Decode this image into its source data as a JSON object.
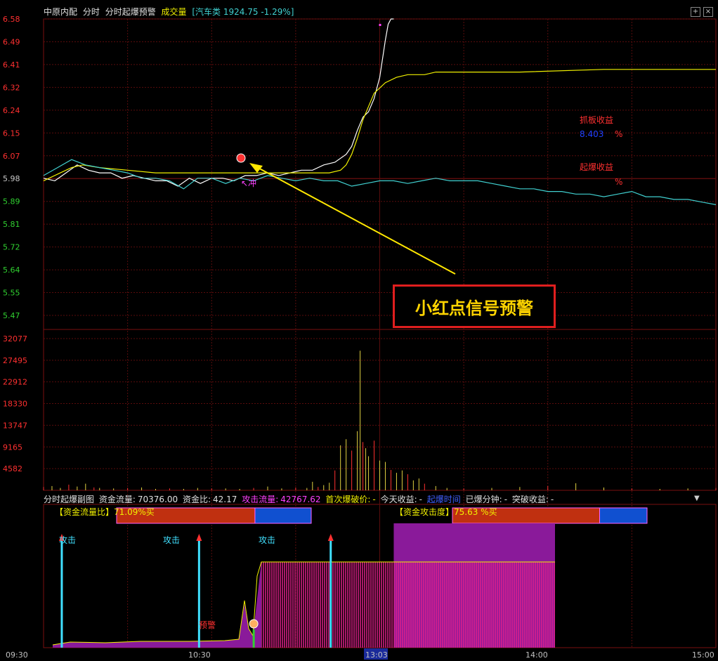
{
  "header": {
    "stock_name": "中原内配",
    "mode": "分时",
    "indicator": "分时起爆预警",
    "volume_label": "成交量",
    "sector": "[汽车类",
    "sector_value": "1924.75 -1.29%]"
  },
  "price_axis": {
    "ticks": [
      "6.58",
      "6.49",
      "6.41",
      "6.32",
      "6.24",
      "6.15",
      "6.07",
      "5.98",
      "5.89",
      "5.81",
      "5.72",
      "5.64",
      "5.55",
      "5.47"
    ],
    "colors": {
      "up": "#ff3030",
      "base": "#c8c8c8",
      "down": "#30d030"
    }
  },
  "volume_axis": {
    "ticks": [
      "32077",
      "27495",
      "22912",
      "18330",
      "13747",
      "9165",
      "4582"
    ]
  },
  "time_axis": {
    "labels": [
      "09:30",
      "10:30",
      "13:03",
      "14:00",
      "15:00"
    ]
  },
  "right_panel": {
    "grab_label": "抓板收益",
    "grab_value": "8.403",
    "grab_unit": "%",
    "burst_label": "起爆收益",
    "burst_unit": "%"
  },
  "signals": {
    "chong": "↖冲",
    "attack": "攻击",
    "warn": "预警"
  },
  "callout": {
    "text": "小红点信号预警"
  },
  "sub_panel": {
    "title": "分时起爆副图",
    "fund_flow_label": "资金流量:",
    "fund_flow_value": "70376.00",
    "fund_ratio_label": "资金比:",
    "fund_ratio_value": "42.17",
    "attack_flow_label": "攻击流量:",
    "attack_flow_value": "42767.62",
    "first_burst_label": "首次爆破价:",
    "first_burst_value": "-",
    "today_gain_label": "今天收益:",
    "today_gain_value": "-",
    "burst_time_label": "起爆时间",
    "burst_minutes_label": "已爆分钟:",
    "burst_minutes_value": "-",
    "breakout_gain_label": "突破收益:",
    "breakout_gain_value": "-",
    "flow_ratio_bar": "【资金流量比】71.09%买",
    "attack_degree_bar": "【资金攻击度】75.63 %买"
  },
  "chart_data": {
    "type": "line",
    "ylim": [
      5.43,
      6.6
    ],
    "base_price": 5.98,
    "time_range": [
      "09:30",
      "15:00"
    ],
    "series": [
      {
        "name": "价格",
        "color": "#ffffff",
        "minute_index": [
          0,
          4,
          8,
          12,
          16,
          20,
          24,
          28,
          32,
          36,
          40,
          44,
          48,
          52,
          56,
          60,
          64,
          68,
          72,
          76,
          80,
          84,
          88,
          92,
          96,
          100,
          104,
          108,
          110,
          112,
          114,
          116,
          118,
          120,
          121,
          122,
          123,
          124,
          125
        ],
        "values": [
          6.0,
          5.99,
          6.02,
          6.05,
          6.03,
          6.02,
          6.02,
          6.0,
          6.01,
          6.0,
          5.99,
          5.99,
          5.97,
          6.0,
          5.98,
          6.0,
          6.0,
          5.99,
          6.01,
          6.01,
          6.02,
          6.01,
          6.02,
          6.03,
          6.03,
          6.05,
          6.06,
          6.09,
          6.12,
          6.18,
          6.23,
          6.25,
          6.3,
          6.38,
          6.45,
          6.52,
          6.58,
          6.6,
          6.6
        ]
      },
      {
        "name": "均价",
        "color": "#f0f000",
        "minute_index": [
          0,
          6,
          10,
          14,
          20,
          30,
          40,
          60,
          80,
          96,
          102,
          106,
          108,
          110,
          112,
          114,
          116,
          118,
          122,
          126,
          130,
          136,
          140,
          150,
          170,
          200,
          230,
          240
        ],
        "values": [
          5.99,
          6.02,
          6.04,
          6.05,
          6.04,
          6.03,
          6.02,
          6.02,
          6.02,
          6.02,
          6.02,
          6.03,
          6.05,
          6.09,
          6.15,
          6.22,
          6.27,
          6.32,
          6.36,
          6.38,
          6.39,
          6.39,
          6.4,
          6.4,
          6.4,
          6.41,
          6.41,
          6.41
        ]
      },
      {
        "name": "汽车类",
        "color": "#40d0d0",
        "minute_index": [
          0,
          5,
          10,
          15,
          20,
          25,
          30,
          35,
          40,
          45,
          50,
          55,
          60,
          65,
          70,
          75,
          80,
          85,
          90,
          95,
          100,
          105,
          110,
          115,
          120,
          125,
          130,
          135,
          140,
          145,
          150,
          155,
          160,
          165,
          170,
          175,
          180,
          185,
          190,
          195,
          200,
          205,
          210,
          215,
          220,
          225,
          230,
          235,
          240
        ],
        "values": [
          6.01,
          6.04,
          6.07,
          6.05,
          6.04,
          6.03,
          6.02,
          6.0,
          6.0,
          5.99,
          5.96,
          6.0,
          6.0,
          5.98,
          6.0,
          5.99,
          6.01,
          6.0,
          5.99,
          6.0,
          5.99,
          5.99,
          5.97,
          5.98,
          5.99,
          5.99,
          5.98,
          5.99,
          6.0,
          5.99,
          5.99,
          5.99,
          5.98,
          5.97,
          5.96,
          5.96,
          5.95,
          5.95,
          5.94,
          5.94,
          5.93,
          5.94,
          5.95,
          5.93,
          5.93,
          5.92,
          5.92,
          5.91,
          5.9
        ]
      }
    ],
    "volume": {
      "ylim": [
        0,
        34000
      ],
      "minute_index": [
        0,
        3,
        6,
        9,
        12,
        15,
        18,
        20,
        25,
        30,
        35,
        40,
        45,
        50,
        55,
        60,
        65,
        70,
        75,
        80,
        85,
        90,
        94,
        96,
        98,
        100,
        102,
        104,
        106,
        108,
        110,
        112,
        113,
        114,
        115,
        116,
        118,
        120,
        122,
        124,
        126,
        128,
        130,
        132,
        134,
        136,
        140,
        144,
        150,
        160,
        170,
        180,
        190,
        200,
        210,
        220,
        230,
        240
      ],
      "values": [
        700,
        900,
        500,
        1200,
        800,
        1400,
        600,
        500,
        400,
        500,
        600,
        300,
        400,
        300,
        500,
        400,
        400,
        300,
        500,
        800,
        400,
        600,
        500,
        1800,
        700,
        1100,
        1600,
        4200,
        9500,
        10800,
        8400,
        12500,
        29500,
        10200,
        8900,
        7200,
        10500,
        6300,
        6000,
        4300,
        3700,
        4200,
        3400,
        2100,
        2500,
        1400,
        900,
        500,
        400,
        500,
        700,
        900,
        1500,
        600,
        400,
        300,
        400,
        500
      ]
    },
    "sub_chart": {
      "flow_ratio_buy_pct": 71.09,
      "attack_degree_buy_pct": 75.63,
      "attack_signals_minute": [
        4,
        53,
        100
      ],
      "warn_signal_minute": 70
    }
  }
}
